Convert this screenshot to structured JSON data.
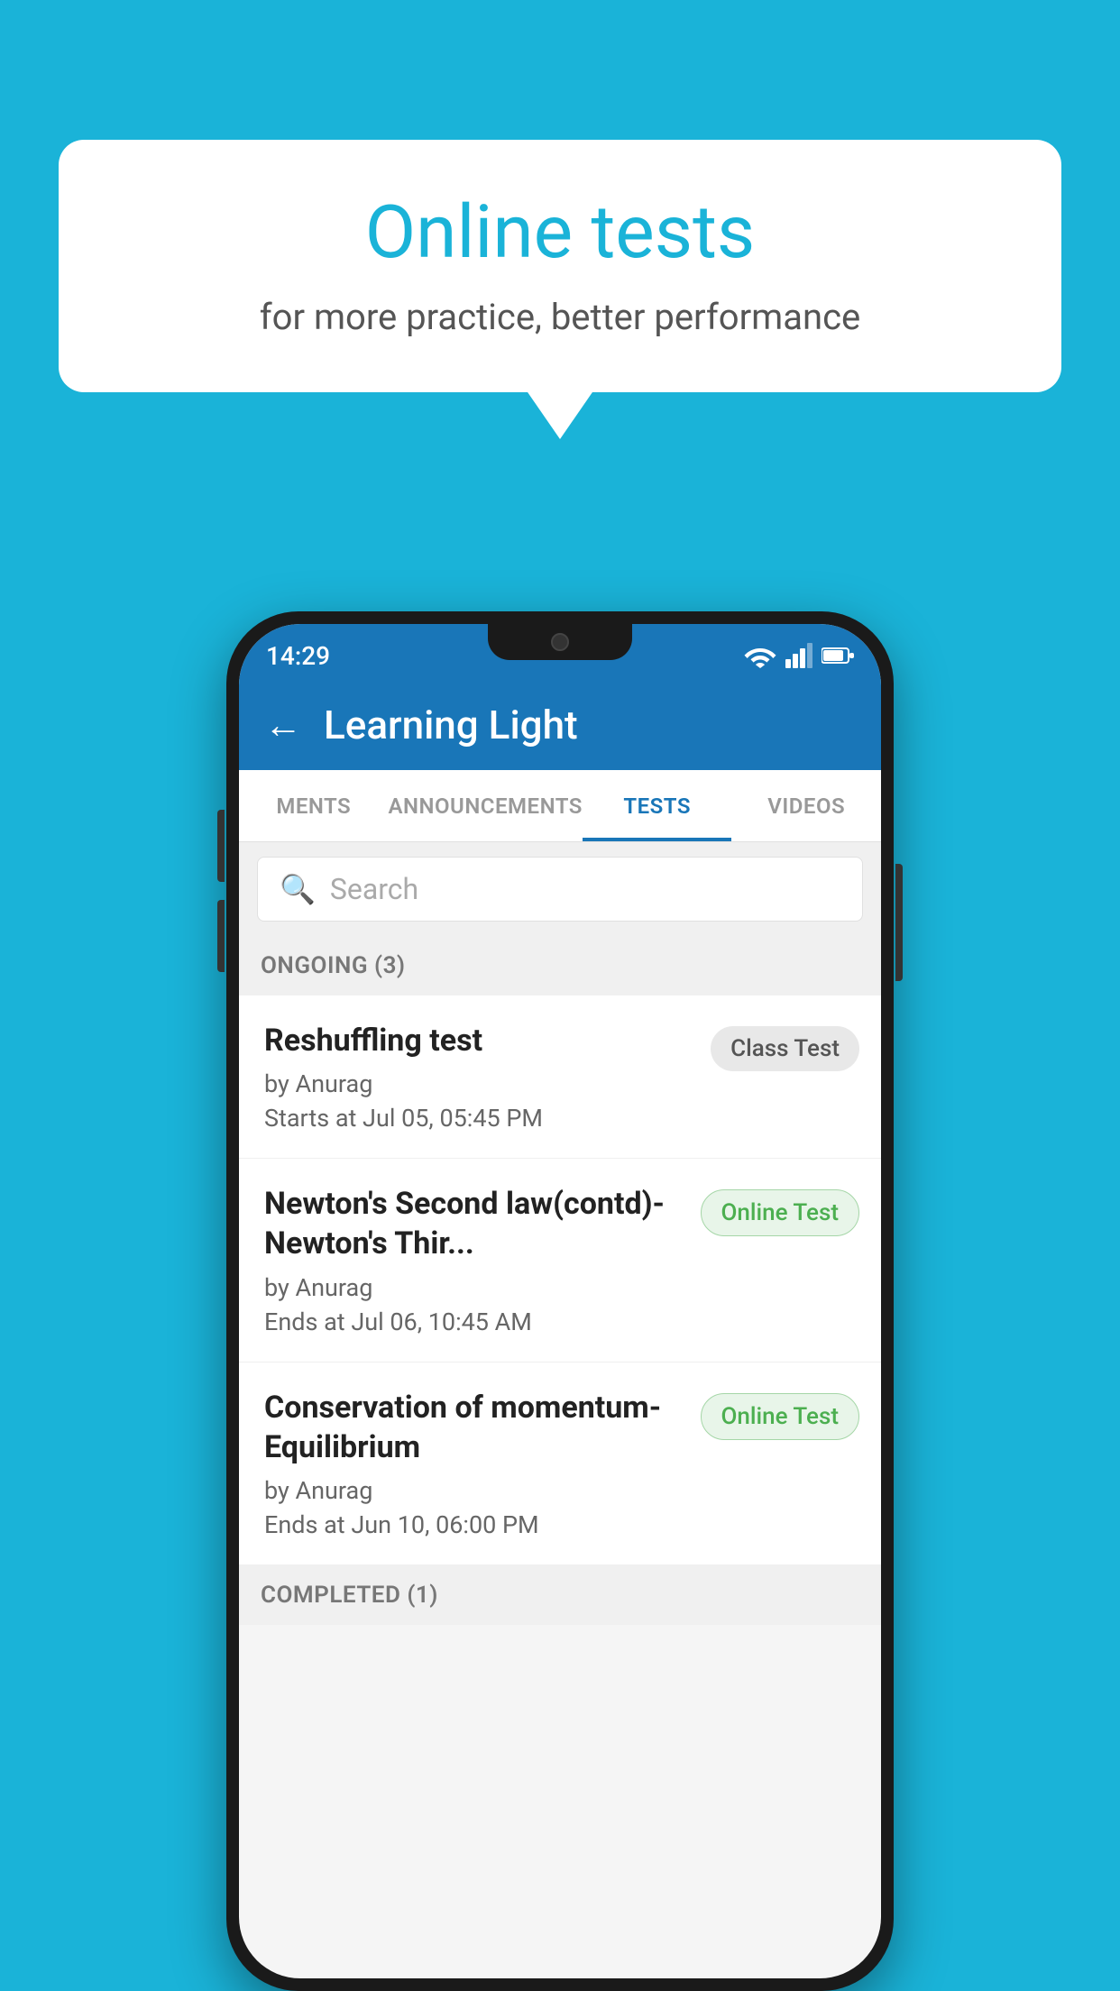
{
  "background": {
    "color": "#1ab3d8"
  },
  "bubble": {
    "title": "Online tests",
    "subtitle": "for more practice, better performance"
  },
  "phone": {
    "status_bar": {
      "time": "14:29",
      "icons": [
        "wifi",
        "signal",
        "battery"
      ]
    },
    "app_bar": {
      "back_label": "←",
      "title": "Learning Light"
    },
    "tabs": [
      {
        "label": "MENTS",
        "active": false
      },
      {
        "label": "ANNOUNCEMENTS",
        "active": false
      },
      {
        "label": "TESTS",
        "active": true
      },
      {
        "label": "VIDEOS",
        "active": false
      }
    ],
    "search": {
      "placeholder": "Search"
    },
    "sections": [
      {
        "header": "ONGOING (3)",
        "items": [
          {
            "title": "Reshuffling test",
            "author": "by Anurag",
            "date": "Starts at  Jul 05, 05:45 PM",
            "badge": "Class Test",
            "badge_type": "class"
          },
          {
            "title": "Newton's Second law(contd)-Newton's Thir...",
            "author": "by Anurag",
            "date": "Ends at  Jul 06, 10:45 AM",
            "badge": "Online Test",
            "badge_type": "online"
          },
          {
            "title": "Conservation of momentum-Equilibrium",
            "author": "by Anurag",
            "date": "Ends at  Jun 10, 06:00 PM",
            "badge": "Online Test",
            "badge_type": "online"
          }
        ]
      },
      {
        "header": "COMPLETED (1)",
        "items": []
      }
    ]
  }
}
